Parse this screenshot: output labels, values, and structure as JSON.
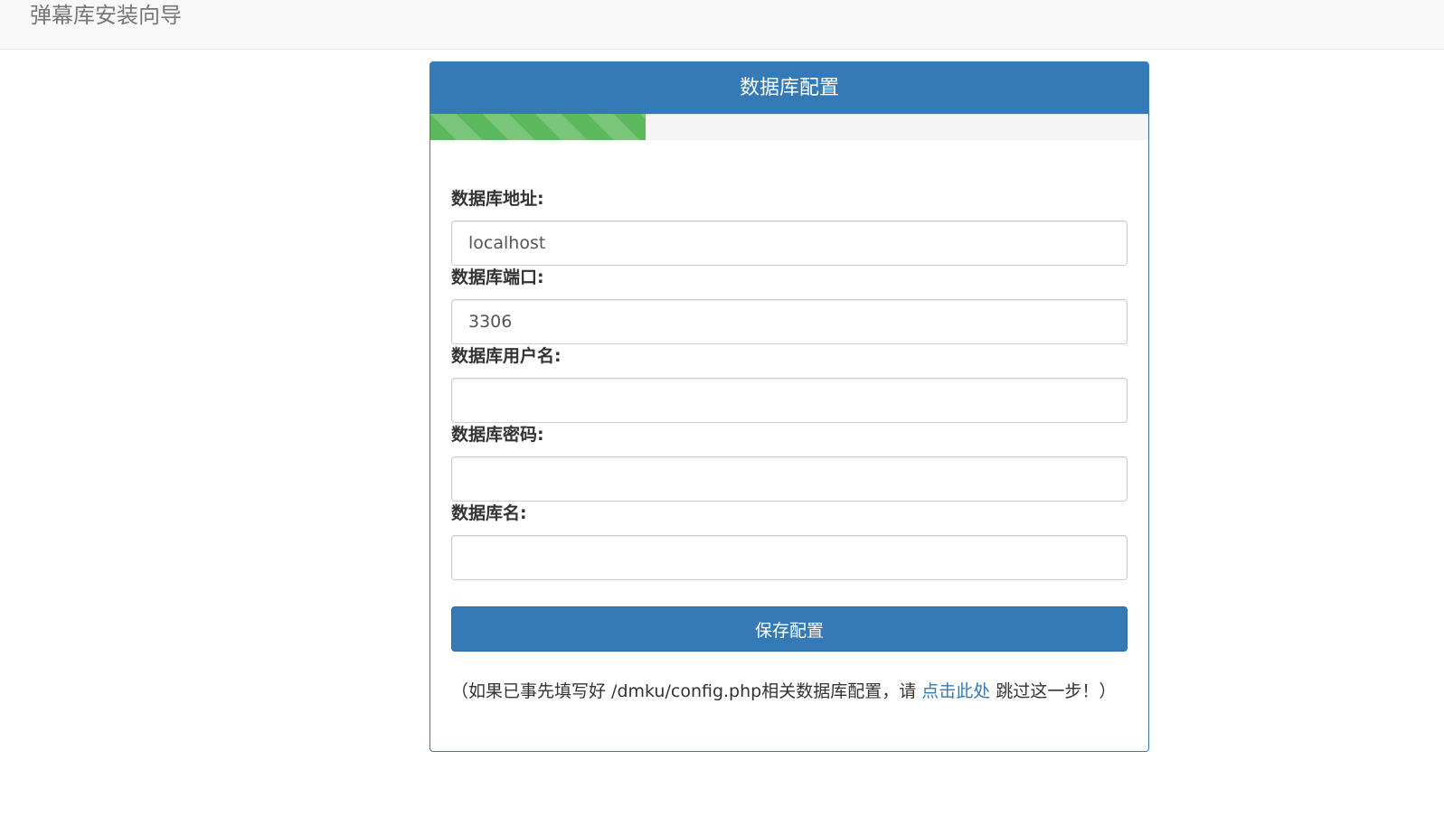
{
  "app": {
    "title": "弹幕库安装向导"
  },
  "panel": {
    "title": "数据库配置",
    "progress_fraction": 0.3
  },
  "fields": [
    {
      "label": "数据库地址:",
      "value": "localhost",
      "placeholder": ""
    },
    {
      "label": "数据库端口:",
      "value": "3306",
      "placeholder": ""
    },
    {
      "label": "数据库用户名:",
      "value": "",
      "placeholder": ""
    },
    {
      "label": "数据库密码:",
      "value": "",
      "placeholder": ""
    },
    {
      "label": "数据库名:",
      "value": "",
      "placeholder": ""
    }
  ],
  "save_button": {
    "label": "保存配置"
  },
  "note": {
    "before": "（如果已事先填写好 /dmku/config.php相关数据库配置，请 ",
    "link": "点击此处",
    "after": " 跳过这一步！）"
  },
  "colors": {
    "primary": "#337ab7",
    "progress": "#5cb85c",
    "navbar_bg": "#f8f8f8"
  }
}
